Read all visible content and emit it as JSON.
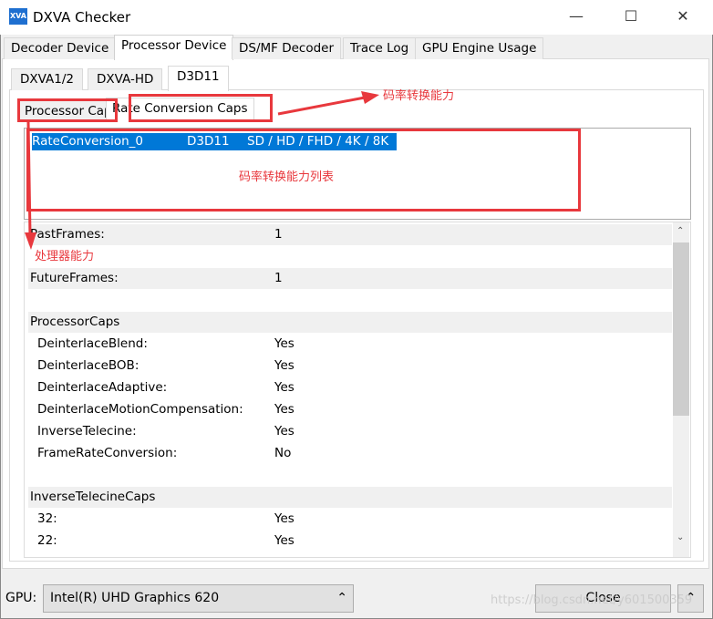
{
  "window": {
    "title": "DXVA Checker",
    "logo": "XVA",
    "controls": [
      "minimize-icon",
      "maximize-icon",
      "close-icon"
    ]
  },
  "main_tabs": [
    {
      "label": "Decoder Device"
    },
    {
      "label": "Processor Device",
      "selected": true
    },
    {
      "label": "DS/MF Decoder"
    },
    {
      "label": "Trace Log"
    },
    {
      "label": "GPU Engine Usage"
    }
  ],
  "sub_tabs": [
    {
      "label": "DXVA1/2"
    },
    {
      "label": "DXVA-HD"
    },
    {
      "label": "D3D11",
      "selected": true
    }
  ],
  "caps_tabs": [
    {
      "label": "Processor Caps"
    },
    {
      "label": "Rate Conversion Caps",
      "selected": true
    }
  ],
  "list": {
    "rows": [
      {
        "name": "RateConversion_0",
        "api": "D3D11",
        "res": "SD / HD / FHD / 4K / 8K",
        "selected": true
      }
    ]
  },
  "props": {
    "past_frames": {
      "label": "PastFrames:",
      "value": "1"
    },
    "future_frames": {
      "label": "FutureFrames:",
      "value": "1"
    },
    "processor_caps": {
      "label": "ProcessorCaps",
      "items": [
        {
          "label": "DeinterlaceBlend:",
          "value": "Yes"
        },
        {
          "label": "DeinterlaceBOB:",
          "value": "Yes"
        },
        {
          "label": "DeinterlaceAdaptive:",
          "value": "Yes"
        },
        {
          "label": "DeinterlaceMotionCompensation:",
          "value": "Yes"
        },
        {
          "label": "InverseTelecine:",
          "value": "Yes"
        },
        {
          "label": "FrameRateConversion:",
          "value": "No"
        }
      ]
    },
    "inverse_telecine_caps": {
      "label": "InverseTelecineCaps",
      "items": [
        {
          "label": "32:",
          "value": "Yes"
        },
        {
          "label": "22:",
          "value": "Yes"
        }
      ]
    }
  },
  "bottom": {
    "gpu_label": "GPU:",
    "gpu_value": "Intel(R) UHD Graphics 620",
    "close_label": "Close",
    "watermark": "https://blog.csdn.net/y601500359"
  },
  "annotations": {
    "rate_caps": "码率转换能力",
    "rate_list": "码率转换能力列表",
    "processor_caps": "处理器能力",
    "color": "#e8383d"
  }
}
